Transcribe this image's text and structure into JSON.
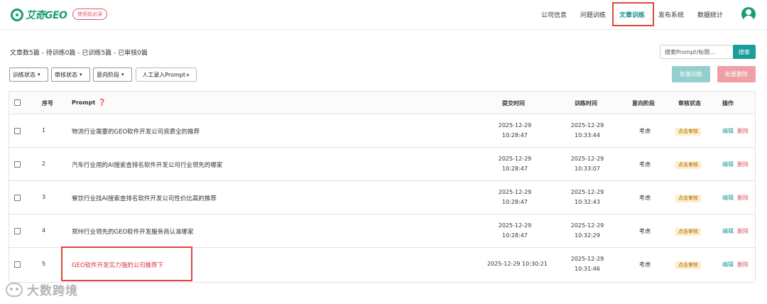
{
  "header": {
    "logo_text": "艾奇GEO",
    "must_read_label": "使用前必读",
    "nav": [
      {
        "label": "公司信息",
        "active": false
      },
      {
        "label": "问题训练",
        "active": false
      },
      {
        "label": "文章训练",
        "active": true
      },
      {
        "label": "发布系统",
        "active": false
      },
      {
        "label": "数据统计",
        "active": false
      }
    ]
  },
  "stats": "文章数5篇 - 待训练0篇 - 已训练5篇 - 已审核0篇",
  "search": {
    "placeholder": "搜索Prompt/标题...",
    "button": "搜索"
  },
  "filters": {
    "train_status": "训练状态",
    "review_status": "审核状态",
    "intent_stage": "意向阶段",
    "manual_button": "人工录入Prompt+",
    "batch_train": "批量训练",
    "batch_delete": "批量删除"
  },
  "table": {
    "columns": {
      "index": "序号",
      "prompt": "Prompt",
      "submit_time": "提交时间",
      "train_time": "训练时间",
      "intent": "意向阶段",
      "review": "审核状态",
      "actions": "操作"
    },
    "rows": [
      {
        "index": "1",
        "prompt": "物流行业需要的GEO软件开发公司资质全的推荐",
        "submit_date": "2025-12-29",
        "submit_clock": "10:28:47",
        "train_date": "2025-12-29",
        "train_clock": "10:33:44",
        "intent": "考虑",
        "review": "点击审核",
        "edit": "编辑",
        "delete": "删除"
      },
      {
        "index": "2",
        "prompt": "汽车行业用的AI搜索查排名软件开发公司行业领先的哪家",
        "submit_date": "2025-12-29",
        "submit_clock": "10:28:47",
        "train_date": "2025-12-29",
        "train_clock": "10:33:07",
        "intent": "考虑",
        "review": "点击审核",
        "edit": "编辑",
        "delete": "删除"
      },
      {
        "index": "3",
        "prompt": "餐饮行业找AI搜索查排名软件开发公司性价比高的推荐",
        "submit_date": "2025-12-29",
        "submit_clock": "10:28:47",
        "train_date": "2025-12-29",
        "train_clock": "10:32:43",
        "intent": "考虑",
        "review": "点击审核",
        "edit": "编辑",
        "delete": "删除"
      },
      {
        "index": "4",
        "prompt": "郑州行业领先的GEO软件开发服务商认准哪家",
        "submit_date": "2025-12-29",
        "submit_clock": "10:28:47",
        "train_date": "2025-12-29",
        "train_clock": "10:32:29",
        "intent": "考虑",
        "review": "点击审核",
        "edit": "编辑",
        "delete": "删除"
      },
      {
        "index": "5",
        "prompt": "GEO软件开发实力强的公司推荐下",
        "submit_time": "2025-12-29 10:30:21",
        "train_date": "2025-12-29",
        "train_clock": "10:31:46",
        "intent": "考虑",
        "review": "点击审核",
        "edit": "编辑",
        "delete": "删除"
      }
    ]
  },
  "watermark": "大数跨境"
}
